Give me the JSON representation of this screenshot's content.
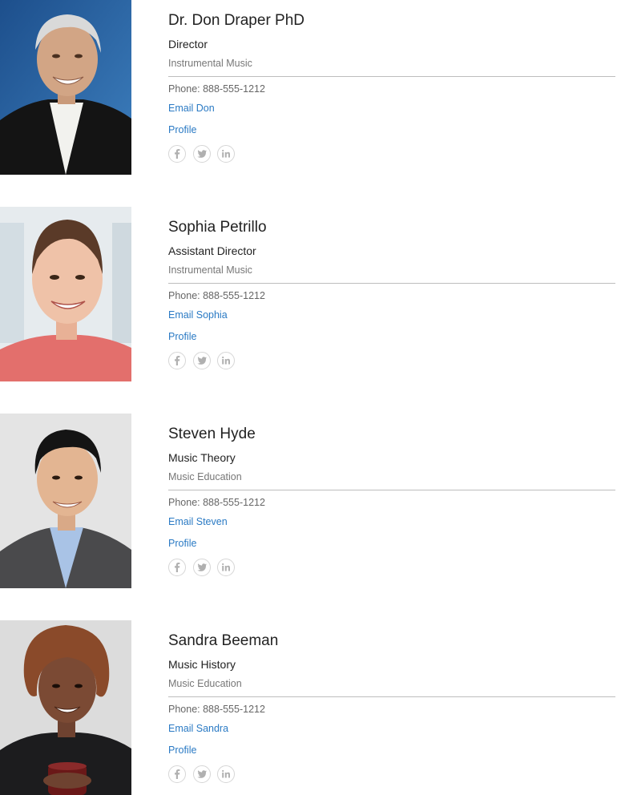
{
  "people": [
    {
      "name": "Dr. Don Draper PhD",
      "title": "Director",
      "department": "Instrumental Music",
      "phone": "Phone: 888-555-1212",
      "email_label": "Email Don",
      "profile_label": "Profile"
    },
    {
      "name": "Sophia Petrillo",
      "title": "Assistant Director",
      "department": "Instrumental Music",
      "phone": "Phone: 888-555-1212",
      "email_label": "Email Sophia",
      "profile_label": "Profile"
    },
    {
      "name": "Steven Hyde",
      "title": "Music Theory",
      "department": "Music Education",
      "phone": "Phone: 888-555-1212",
      "email_label": "Email Steven",
      "profile_label": "Profile"
    },
    {
      "name": "Sandra Beeman",
      "title": "Music History",
      "department": "Music Education",
      "phone": "Phone: 888-555-1212",
      "email_label": "Email Sandra",
      "profile_label": "Profile"
    }
  ],
  "social_icons": [
    "facebook-icon",
    "twitter-icon",
    "linkedin-icon"
  ],
  "colors": {
    "link": "#2a7ac4",
    "icon": "#b0b0b0",
    "divider": "#bdbdbd"
  }
}
